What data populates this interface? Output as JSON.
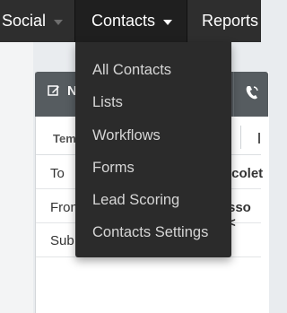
{
  "topnav": {
    "items": [
      {
        "label": "Social"
      },
      {
        "label": "Contacts"
      },
      {
        "label": "Reports"
      }
    ]
  },
  "dropdown": {
    "items": [
      {
        "label": "All Contacts"
      },
      {
        "label": "Lists"
      },
      {
        "label": "Workflows"
      },
      {
        "label": "Forms"
      },
      {
        "label": "Lead Scoring"
      },
      {
        "label": "Contacts Settings"
      }
    ]
  },
  "card": {
    "header_letter": "N",
    "tab_label": "Tem",
    "rows": [
      {
        "label": "To",
        "value": "icolet"
      },
      {
        "label": "Fron",
        "value": "sso <"
      },
      {
        "label": "Sub",
        "value": ""
      }
    ]
  },
  "colors": {
    "topnav_bg": "#2e2e2e",
    "active_tab_bg": "#1f1f1f",
    "dropdown_bg": "#2b2b2b",
    "card_header_bg": "#565c60"
  }
}
